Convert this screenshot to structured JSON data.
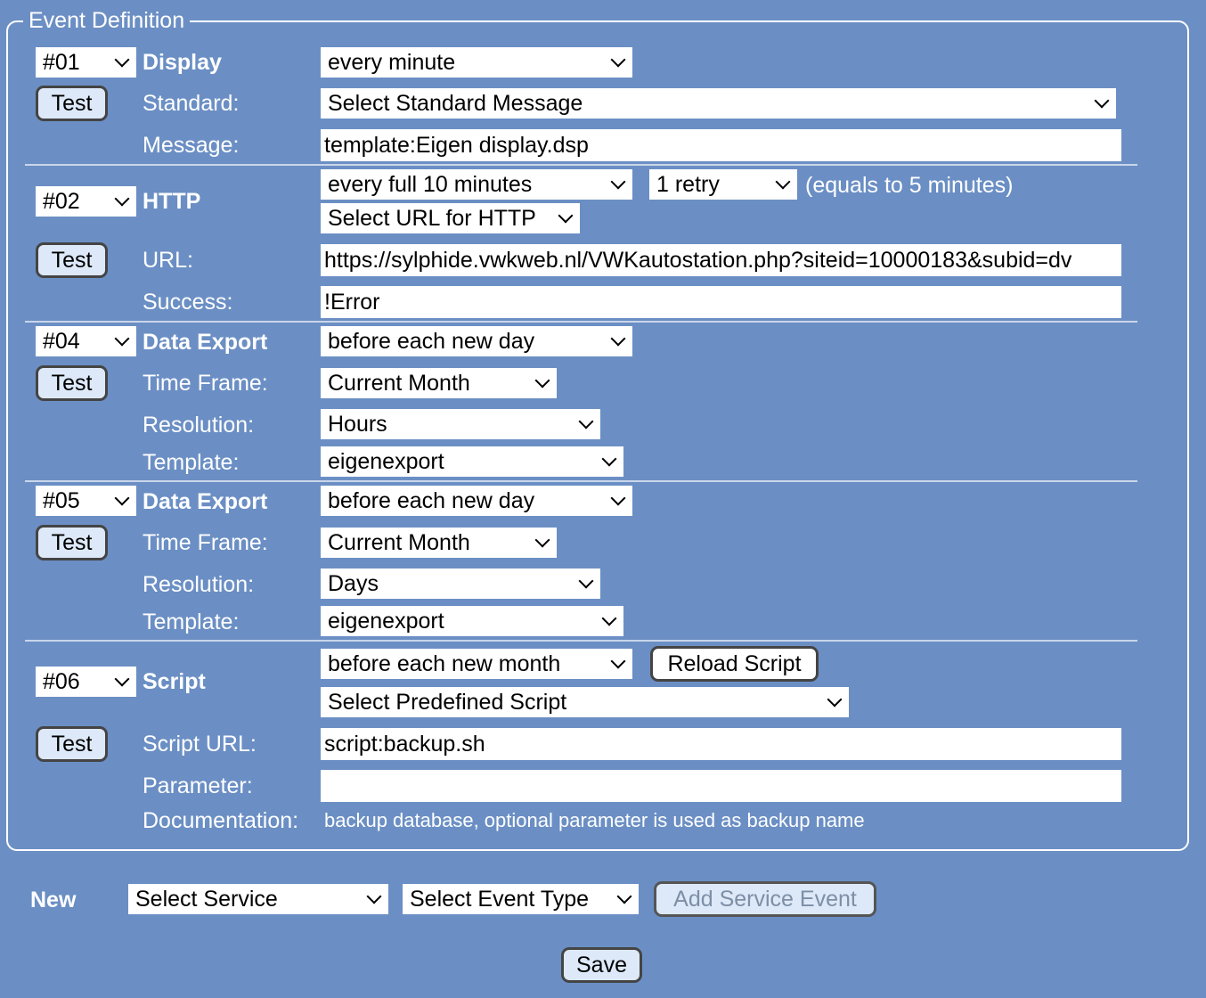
{
  "legend": "Event Definition",
  "test_label": "Test",
  "events": {
    "e01": {
      "id": "#01",
      "type": "Display",
      "schedule": "every minute",
      "standard_label": "Standard:",
      "standard_value": "Select Standard Message",
      "message_label": "Message:",
      "message_value": "template:Eigen display.dsp"
    },
    "e02": {
      "id": "#02",
      "type": "HTTP",
      "schedule": "every full 10 minutes",
      "retry": "1 retry",
      "retry_note": "(equals to 5 minutes)",
      "url_select": "Select URL for HTTP",
      "url_label": "URL:",
      "url_value": "https://sylphide.vwkweb.nl/VWKautostation.php?siteid=10000183&subid=dv",
      "success_label": "Success:",
      "success_value": "!Error"
    },
    "e04": {
      "id": "#04",
      "type": "Data Export",
      "schedule": "before each new day",
      "timeframe_label": "Time Frame:",
      "timeframe_value": "Current Month",
      "resolution_label": "Resolution:",
      "resolution_value": "Hours",
      "template_label": "Template:",
      "template_value": "eigenexport"
    },
    "e05": {
      "id": "#05",
      "type": "Data Export",
      "schedule": "before each new day",
      "timeframe_label": "Time Frame:",
      "timeframe_value": "Current Month",
      "resolution_label": "Resolution:",
      "resolution_value": "Days",
      "template_label": "Template:",
      "template_value": "eigenexport"
    },
    "e06": {
      "id": "#06",
      "type": "Script",
      "schedule": "before each new month",
      "reload_label": "Reload Script",
      "predefined": "Select Predefined Script",
      "scripturl_label": "Script URL:",
      "scripturl_value": "script:backup.sh",
      "parameter_label": "Parameter:",
      "parameter_value": "",
      "doc_label": "Documentation:",
      "doc_value": "backup database, optional parameter is used as backup name"
    }
  },
  "new": {
    "label": "New",
    "service_select": "Select Service",
    "event_type_select": "Select Event Type",
    "add_button": "Add Service Event"
  },
  "save_label": "Save"
}
